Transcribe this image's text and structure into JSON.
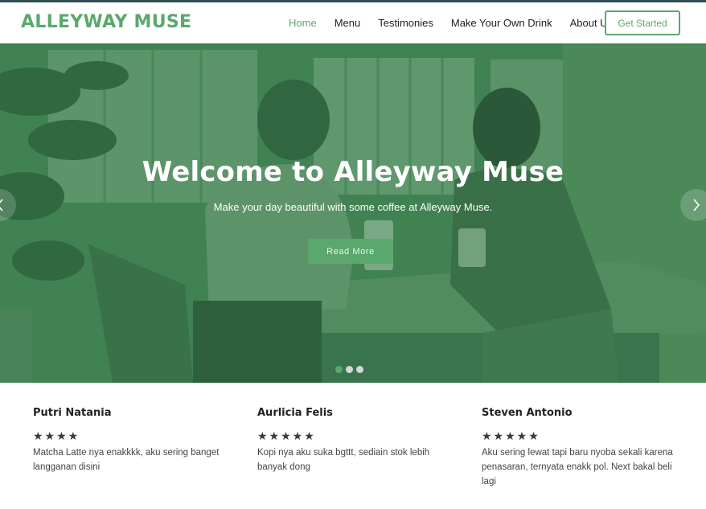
{
  "brand": {
    "name": "ALLEYWAY MUSE",
    "accent_color": "#5aa86d"
  },
  "nav": {
    "items": [
      {
        "label": "Home",
        "active": true
      },
      {
        "label": "Menu",
        "active": false
      },
      {
        "label": "Testimonies",
        "active": false
      },
      {
        "label": "Make Your Own Drink",
        "active": false
      },
      {
        "label": "About Us",
        "active": false
      }
    ],
    "cta_label": "Get Started"
  },
  "hero": {
    "title": "Welcome to Alleyway Muse",
    "subtitle": "Make your day beautiful with some coffee at Alleyway Muse.",
    "button_label": "Read More",
    "prev_icon": "chevron-left-icon",
    "next_icon": "chevron-right-icon",
    "slides_count": 3,
    "active_slide": 1
  },
  "testimonials": [
    {
      "name": "Putri Natania",
      "rating": 4,
      "stars": "★★★★",
      "quote": "Matcha Latte nya enakkkk, aku sering banget langganan disini"
    },
    {
      "name": "Aurlicia Felis",
      "rating": 5,
      "stars": "★★★★★",
      "quote": "Kopi nya aku suka bgttt, sediain stok lebih banyak dong"
    },
    {
      "name": "Steven Antonio",
      "rating": 5,
      "stars": "★★★★★",
      "quote": "Aku sering lewat tapi baru nyoba sekali karena penasaran, ternyata enakk pol. Next bakal beli lagi"
    }
  ]
}
